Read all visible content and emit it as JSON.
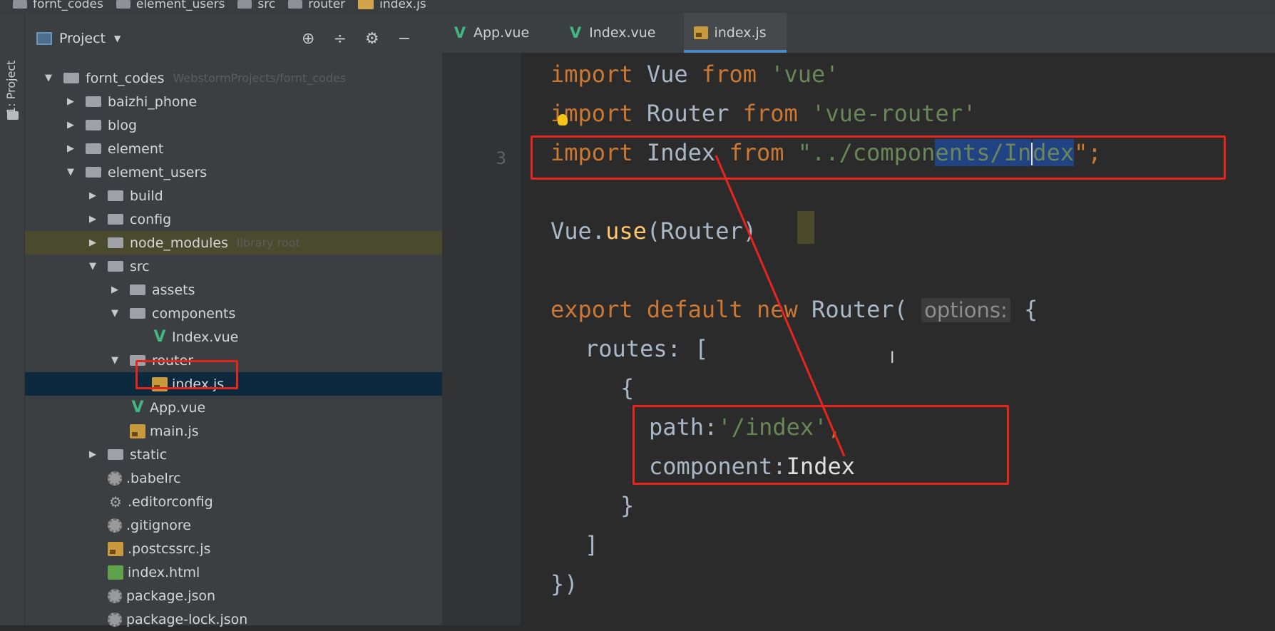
{
  "breadcrumb": [
    "fornt_codes",
    "element_users",
    "src",
    "router",
    "index.js"
  ],
  "toolstrip": {
    "label": "1: Project"
  },
  "panel": {
    "title": "Project",
    "tree": [
      {
        "label": "fornt_codes",
        "hint": "WebstormProjects/fornt_codes",
        "depth": 0,
        "arrow": "down",
        "icon": "folder"
      },
      {
        "label": "baizhi_phone",
        "depth": 1,
        "arrow": "right",
        "icon": "folder"
      },
      {
        "label": "blog",
        "depth": 1,
        "arrow": "right",
        "icon": "folder"
      },
      {
        "label": "element",
        "depth": 1,
        "arrow": "right",
        "icon": "folder"
      },
      {
        "label": "element_users",
        "depth": 1,
        "arrow": "down",
        "icon": "folder"
      },
      {
        "label": "build",
        "depth": 2,
        "arrow": "right",
        "icon": "folder"
      },
      {
        "label": "config",
        "depth": 2,
        "arrow": "right",
        "icon": "folder"
      },
      {
        "label": "node_modules",
        "hint": "library root",
        "depth": 2,
        "arrow": "right",
        "icon": "folder"
      },
      {
        "label": "src",
        "depth": 2,
        "arrow": "down",
        "icon": "folder"
      },
      {
        "label": "assets",
        "depth": 3,
        "arrow": "right",
        "icon": "folder"
      },
      {
        "label": "components",
        "depth": 3,
        "arrow": "down",
        "icon": "folder"
      },
      {
        "label": "Index.vue",
        "depth": 4,
        "arrow": "none",
        "icon": "vue"
      },
      {
        "label": "router",
        "depth": 3,
        "arrow": "down",
        "icon": "folder"
      },
      {
        "label": "index.js",
        "depth": 4,
        "arrow": "none",
        "icon": "js",
        "selected": true
      },
      {
        "label": "App.vue",
        "depth": 3,
        "arrow": "none",
        "icon": "vue"
      },
      {
        "label": "main.js",
        "depth": 3,
        "arrow": "none",
        "icon": "js"
      },
      {
        "label": "static",
        "depth": 2,
        "arrow": "right",
        "icon": "folder"
      },
      {
        "label": ".babelrc",
        "depth": 2,
        "arrow": "none",
        "icon": "config"
      },
      {
        "label": ".editorconfig",
        "depth": 2,
        "arrow": "none",
        "icon": "gear"
      },
      {
        "label": ".gitignore",
        "depth": 2,
        "arrow": "none",
        "icon": "config"
      },
      {
        "label": ".postcssrc.js",
        "depth": 2,
        "arrow": "none",
        "icon": "js"
      },
      {
        "label": "index.html",
        "depth": 2,
        "arrow": "none",
        "icon": "html"
      },
      {
        "label": "package.json",
        "depth": 2,
        "arrow": "none",
        "icon": "config"
      },
      {
        "label": "package-lock.json",
        "depth": 2,
        "arrow": "none",
        "icon": "config"
      }
    ]
  },
  "tabs": [
    {
      "label": "App.vue",
      "icon": "vue"
    },
    {
      "label": "Index.vue",
      "icon": "vue"
    },
    {
      "label": "index.js",
      "icon": "js",
      "active": true
    }
  ],
  "gutter": [
    "",
    "",
    "3",
    "",
    "",
    "",
    "",
    "",
    "",
    "",
    "",
    "",
    "",
    ""
  ],
  "code": {
    "l1": {
      "kw1": "import",
      "id": " Vue ",
      "kw2": "from",
      "str": " 'vue'"
    },
    "l2": {
      "kw1": "import",
      "id": " Router ",
      "kw2": "from",
      "str": " 'vue-router'"
    },
    "l3": {
      "kw1": "import",
      "id": " Index ",
      "kw2": "from",
      "str1": " \"../compon",
      "str2": "ents/In",
      "str3": "dex",
      "end": "\";"
    },
    "l5": {
      "id1": "Vue.",
      "fn": "use",
      "id2": "(Router)"
    },
    "l7": {
      "kw": "export default new",
      "id": " Router( ",
      "hint": "options:",
      "id2": " {"
    },
    "l8": {
      "id": "routes: ["
    },
    "l9": {
      "id": "{"
    },
    "l10": {
      "id": "path:",
      "str": "'/index'",
      "kw": ","
    },
    "l11": {
      "id1": "component:",
      "id2": "Index"
    },
    "l12": {
      "id": "}"
    },
    "l13": {
      "id": "]"
    },
    "l14": {
      "id": "})"
    }
  },
  "colors": {
    "annotation": "#e8241f",
    "keyword": "#cc7832",
    "string": "#6a8759",
    "selection": "#0d293e"
  }
}
